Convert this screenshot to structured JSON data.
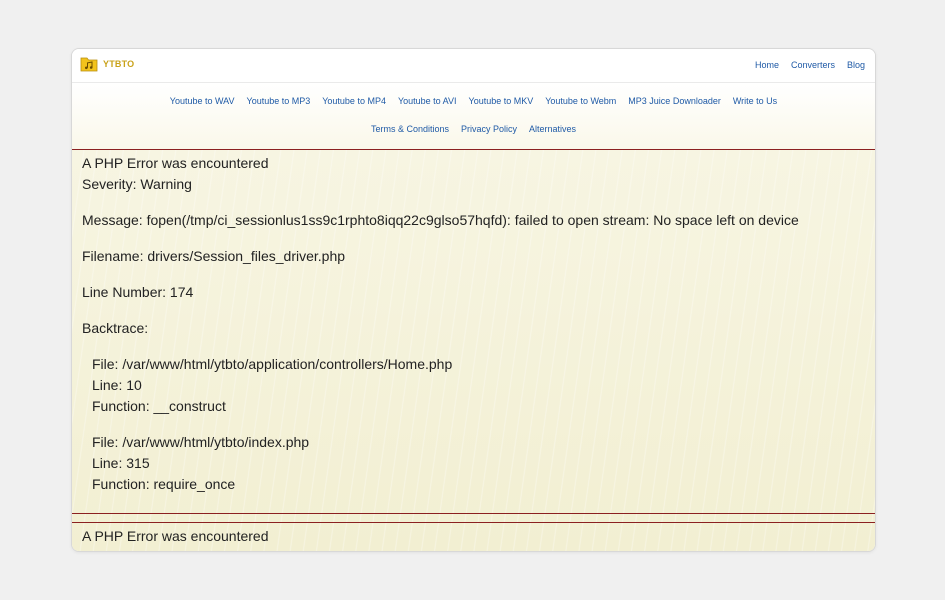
{
  "logo": {
    "text": "YTBTO"
  },
  "topnav": {
    "home": "Home",
    "converters": "Converters",
    "blog": "Blog"
  },
  "subnav": {
    "row1": [
      "Youtube to WAV",
      "Youtube to MP3",
      "Youtube to MP4",
      "Youtube to AVI",
      "Youtube to MKV",
      "Youtube to Webm",
      "MP3 Juice Downloader",
      "Write to Us"
    ],
    "row2": [
      "Terms & Conditions",
      "Privacy Policy",
      "Alternatives"
    ]
  },
  "error1": {
    "heading": "A PHP Error was encountered",
    "severity": "Severity: Warning",
    "message": "Message: fopen(/tmp/ci_sessionlus1ss9c1rphto8iqq22c9glso57hqfd): failed to open stream: No space left on device",
    "filename": "Filename: drivers/Session_files_driver.php",
    "line_number": "Line Number: 174",
    "backtrace_label": "Backtrace:",
    "trace": [
      {
        "file": "File: /var/www/html/ytbto/application/controllers/Home.php",
        "line": "Line: 10",
        "function": "Function: __construct"
      },
      {
        "file": "File: /var/www/html/ytbto/index.php",
        "line": "Line: 315",
        "function": "Function: require_once"
      }
    ]
  },
  "error2": {
    "heading": "A PHP Error was encountered"
  },
  "colors": {
    "link": "#1f5aa6",
    "logo": "#c9a21a",
    "error_rule": "#8b2020",
    "content_bg": "#f6f3dd"
  }
}
